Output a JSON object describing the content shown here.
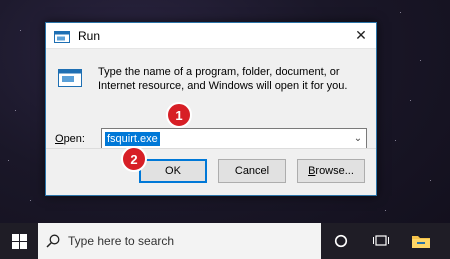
{
  "dialog": {
    "title": "Run",
    "description": "Type the name of a program, folder, document, or Internet resource, and Windows will open it for you.",
    "open_label_prefix": "",
    "open_label_underlined": "O",
    "open_label_rest": "pen:",
    "open_value": "fsquirt.exe",
    "buttons": {
      "ok": "OK",
      "cancel": "Cancel",
      "browse_underlined": "B",
      "browse_rest": "rowse..."
    }
  },
  "annotations": {
    "step1": "1",
    "step2": "2",
    "color": "#d71f26"
  },
  "taskbar": {
    "search_placeholder": "Type here to search",
    "icons": [
      "windows-start-icon",
      "search-icon",
      "cortana-circle-icon",
      "task-view-icon",
      "file-explorer-icon"
    ]
  },
  "colors": {
    "accent": "#0078d7",
    "dialog_border": "#2b74a8"
  }
}
